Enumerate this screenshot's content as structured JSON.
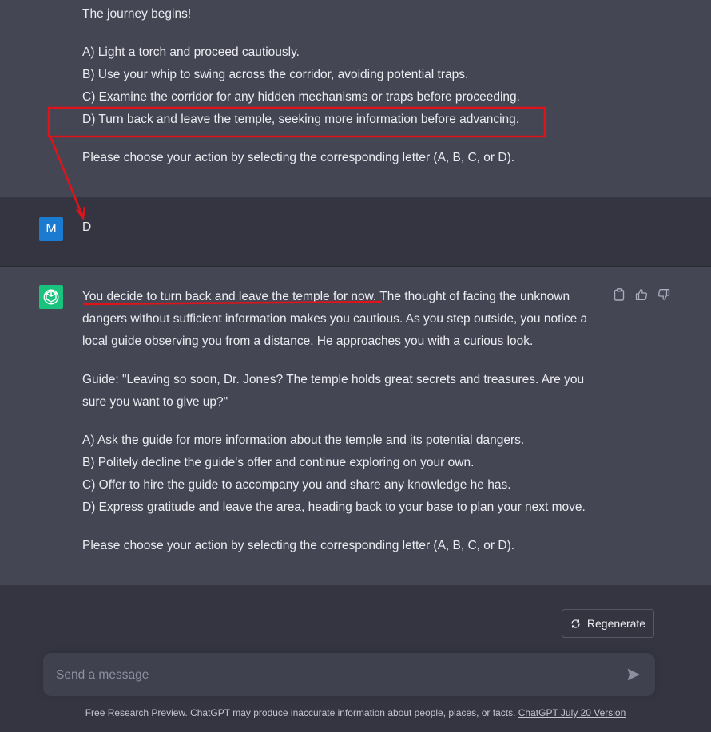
{
  "conversation": {
    "prev_assistant": {
      "lines": [
        "The journey begins!",
        "A) Light a torch and proceed cautiously.",
        "B) Use your whip to swing across the corridor, avoiding potential traps.",
        "C) Examine the corridor for any hidden mechanisms or traps before proceeding.",
        "D) Turn back and leave the temple, seeking more information before advancing.",
        "Please choose your action by selecting the corresponding letter (A, B, C, or D)."
      ]
    },
    "user": {
      "avatar_letter": "M",
      "message": "D"
    },
    "assistant": {
      "underlined_part": "You decide to turn back and leave the temple for now.",
      "line1_rest": " The thought of facing the unknown",
      "lines": [
        "dangers without sufficient information makes you cautious. As you step outside, you notice a",
        "local guide observing you from a distance. He approaches you with a curious look.",
        "Guide: \"Leaving so soon, Dr. Jones? The temple holds great secrets and treasures. Are you",
        "sure you want to give up?\"",
        "A) Ask the guide for more information about the temple and its potential dangers.",
        "B) Politely decline the guide's offer and continue exploring on your own.",
        "C) Offer to hire the guide to accompany you and share any knowledge he has.",
        "D) Express gratitude and leave the area, heading back to your base to plan your next move.",
        "Please choose your action by selecting the corresponding letter (A, B, C, or D)."
      ],
      "icons": [
        "clipboard-icon",
        "thumbs-up-icon",
        "thumbs-down-icon"
      ]
    }
  },
  "controls": {
    "regenerate_label": "Regenerate",
    "input_placeholder": "Send a message"
  },
  "footer": {
    "text": "Free Research Preview. ChatGPT may produce inaccurate information about people, places, or facts.",
    "link": "ChatGPT July 20 Version"
  },
  "annotations": {
    "highlight_color": "#e0131b"
  }
}
